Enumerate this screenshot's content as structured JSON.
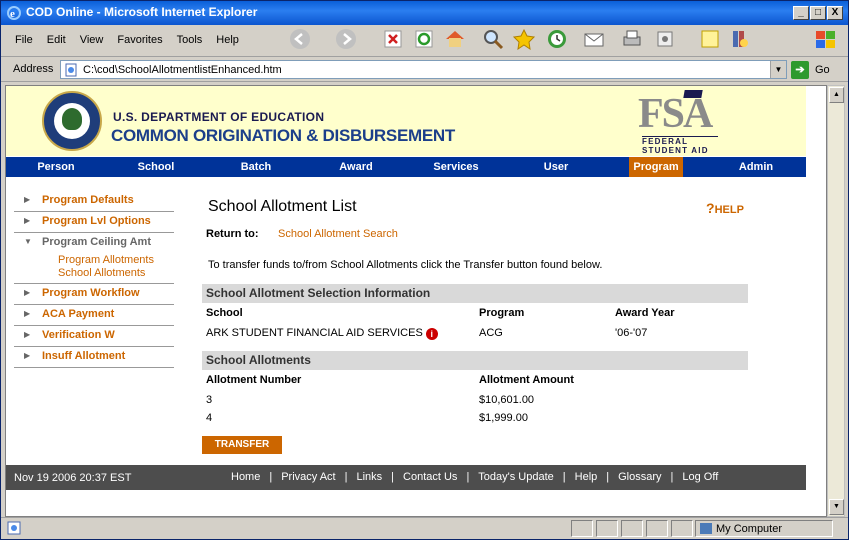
{
  "window": {
    "title": "COD Online - Microsoft Internet Explorer",
    "min": "_",
    "max": "□",
    "close": "X"
  },
  "menu": {
    "items": [
      "File",
      "Edit",
      "View",
      "Favorites",
      "Tools",
      "Help"
    ]
  },
  "address": {
    "label": "Address",
    "url": "C:\\cod\\SchoolAllotmentlistEnhanced.htm",
    "go": "Go"
  },
  "header": {
    "dept_line1": "U.S. DEPARTMENT OF EDUCATION",
    "dept_line2": "COMMON ORIGINATION & DISBURSEMENT",
    "fsa_big": "FSA",
    "fsa_small": "FEDERAL STUDENT AID"
  },
  "nav": {
    "items": [
      "Person",
      "School",
      "Batch",
      "Award",
      "Services",
      "User",
      "Program",
      "Admin"
    ],
    "active": "Program"
  },
  "sidebar": {
    "items": [
      "Program Defaults",
      "Program Lvl Options",
      "Program Ceiling Amt",
      "Program Workflow",
      "ACA Payment",
      "Verification W",
      "Insuff Allotment"
    ],
    "sub_items": [
      "Program Allotments",
      "School Allotments"
    ]
  },
  "main": {
    "title": "School Allotment List",
    "help": "HELP",
    "return_label": "Return to:",
    "return_link": "School Allotment Search",
    "instructions": "To transfer funds to/from School Allotments click the Transfer button found below.",
    "section1": {
      "title": "School Allotment Selection Information",
      "headers": [
        "School",
        "Program",
        "Award Year"
      ],
      "row": [
        "ARK STUDENT FINANCIAL AID SERVICES",
        "ACG",
        "'06-'07"
      ]
    },
    "section2": {
      "title": "School Allotments",
      "headers": [
        "Allotment Number",
        "Allotment Amount"
      ],
      "rows": [
        [
          "3",
          "$10,601.00"
        ],
        [
          "4",
          "$1,999.00"
        ]
      ]
    },
    "transfer": "TRANSFER"
  },
  "footer": {
    "datetime": "Nov 19 2006 20:37 EST",
    "links": [
      "Home",
      "Privacy Act",
      "Links",
      "Contact Us",
      "Today's Update",
      "Help",
      "Glossary",
      "Log Off"
    ]
  },
  "status": {
    "zone": "My Computer"
  },
  "colors": {
    "accent": "#cc6600",
    "nav": "#003399",
    "header_bg": "#ffffcc"
  }
}
